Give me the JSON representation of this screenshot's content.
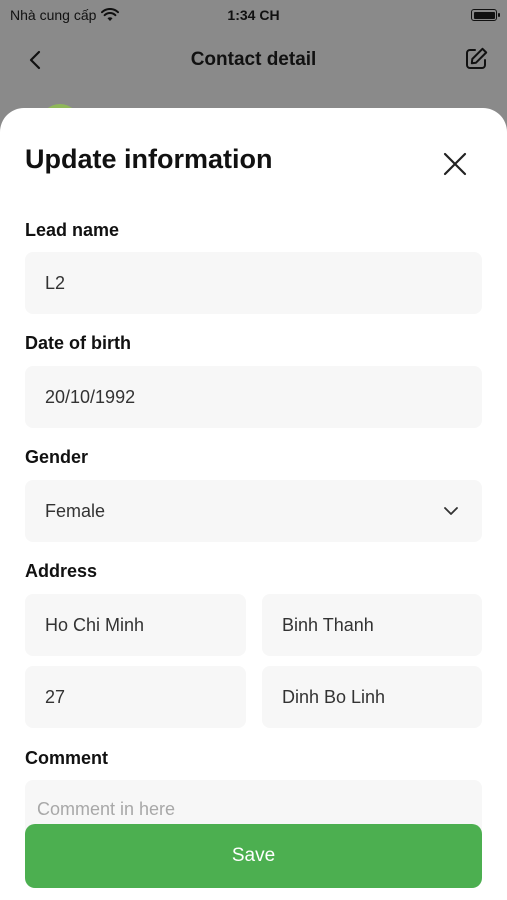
{
  "status_bar": {
    "carrier": "Nhà cung cấp",
    "time": "1:34 CH"
  },
  "nav": {
    "title": "Contact detail"
  },
  "sheet": {
    "title": "Update information",
    "fields": {
      "lead_name": {
        "label": "Lead name",
        "value": "L2"
      },
      "date_of_birth": {
        "label": "Date of birth",
        "value": "20/10/1992"
      },
      "gender": {
        "label": "Gender",
        "value": "Female"
      },
      "address": {
        "label": "Address",
        "city": "Ho Chi Minh",
        "district": "Binh Thanh",
        "number": "27",
        "street": "Dinh Bo Linh"
      },
      "comment": {
        "label": "Comment",
        "placeholder": "Comment in here"
      }
    },
    "save_label": "Save"
  },
  "colors": {
    "accent": "#4caf50",
    "field_bg": "#f7f7f7",
    "backdrop": "#8a8a8a"
  }
}
